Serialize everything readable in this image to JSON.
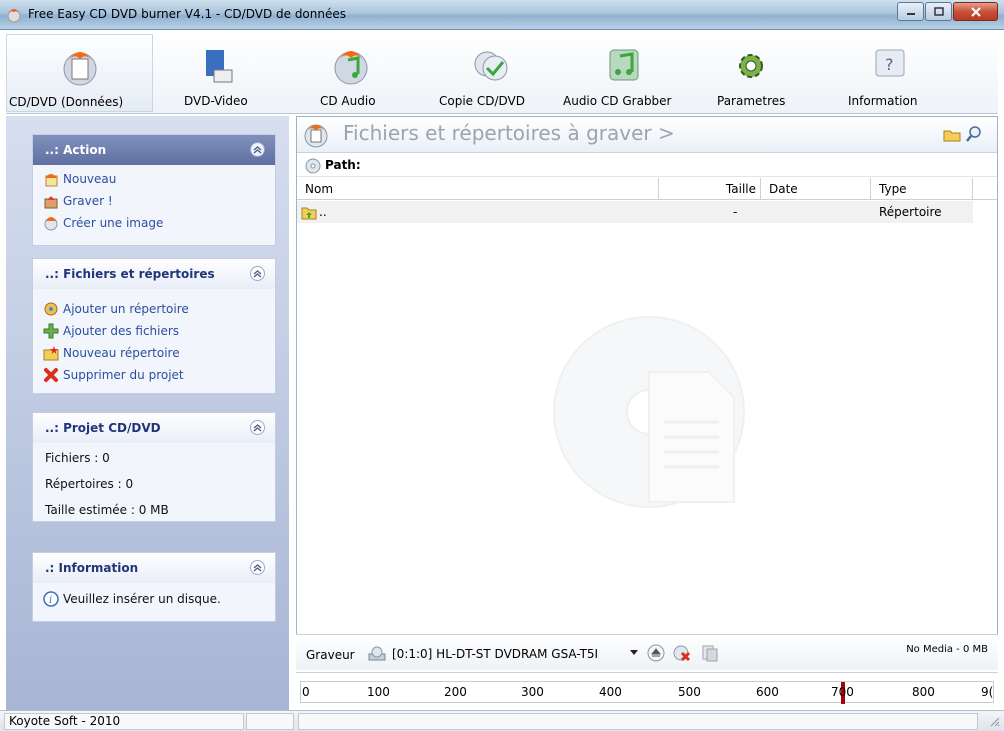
{
  "window": {
    "title": "Free Easy CD DVD burner V4.1 - CD/DVD de données"
  },
  "toolbar": {
    "items": [
      {
        "label": "CD/DVD (Données)",
        "icon": "cd-data-icon"
      },
      {
        "label": "DVD-Video",
        "icon": "dvd-video-icon"
      },
      {
        "label": "CD Audio",
        "icon": "cd-audio-icon"
      },
      {
        "label": "Copie CD/DVD",
        "icon": "copy-cd-icon"
      },
      {
        "label": "Audio CD Grabber",
        "icon": "audio-grabber-icon"
      },
      {
        "label": "Parametres",
        "icon": "gear-icon"
      },
      {
        "label": "Information",
        "icon": "help-icon"
      }
    ]
  },
  "sidebar": {
    "action": {
      "title": "..: Action",
      "items": [
        {
          "label": "Nouveau",
          "icon": "new-icon"
        },
        {
          "label": "Graver !",
          "icon": "burn-icon"
        },
        {
          "label": "Créer une image",
          "icon": "create-image-icon"
        }
      ]
    },
    "files": {
      "title": "..: Fichiers et répertoires",
      "items": [
        {
          "label": "Ajouter un répertoire",
          "icon": "add-folder-icon"
        },
        {
          "label": "Ajouter des fichiers",
          "icon": "add-files-icon"
        },
        {
          "label": "Nouveau répertoire",
          "icon": "new-folder-icon"
        },
        {
          "label": "Supprimer du projet",
          "icon": "delete-icon"
        }
      ]
    },
    "project": {
      "title": "..: Projet CD/DVD",
      "lines": [
        "Fichiers : 0",
        "Répertoires : 0",
        "Taille estimée : 0 MB"
      ]
    },
    "info": {
      "title": ".: Information",
      "message": "Veuillez insérer un disque."
    }
  },
  "main": {
    "title": "Fichiers et répertoires à graver >",
    "path_label": "Path:",
    "columns": [
      "Nom",
      "Taille",
      "Date",
      "Type"
    ],
    "rows": [
      {
        "name": "..",
        "size": "-",
        "date": "",
        "type": "Répertoire"
      }
    ]
  },
  "burner": {
    "label": "Graveur",
    "drive": "[0:1:0] HL-DT-ST DVDRAM GSA-T5I",
    "status": "No Media - 0 MB"
  },
  "ruler": {
    "ticks": [
      "0",
      "100",
      "200",
      "300",
      "400",
      "500",
      "600",
      "700",
      "800",
      "9("
    ],
    "marker_value": 700
  },
  "statusbar": {
    "text": "Koyote Soft - 2010"
  },
  "colors": {
    "sidebar_header": "#5f6fa1",
    "link": "#2a4fa0",
    "marker": "#b00000"
  }
}
